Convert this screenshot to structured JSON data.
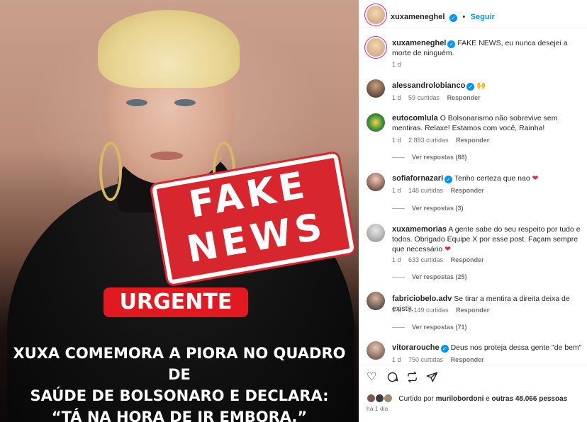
{
  "post": {
    "stamp_line1": "FAKE",
    "stamp_line2": "NEWS",
    "badge": "URGENTE",
    "headline_1": "XUXA COMEMORA A PIORA NO QUADRO DE",
    "headline_2": "SAÚDE DE BOLSONARO E DECLARA:",
    "headline_3": "“TÁ NA HORA DE IR EMBORA.”"
  },
  "header": {
    "username": "xuxameneghel",
    "separator": "•",
    "follow_label": "Seguir"
  },
  "caption": {
    "username": "xuxameneghel",
    "text": "FAKE NEWS, eu nunca desejei a morte de ninguém.",
    "time": "1 d"
  },
  "comments": [
    {
      "username": "alessandrolobianco",
      "verified": true,
      "text": "🙌",
      "time": "1 d",
      "likes": "59 curtidas",
      "reply": "Responder",
      "view_replies": ""
    },
    {
      "username": "eutocomlula",
      "verified": false,
      "text": "O Bolsonarismo não sobrevive sem mentiras. Relaxe! Estamos com você, Rainha!",
      "time": "1 d",
      "likes": "2.883 curtidas",
      "reply": "Responder",
      "view_replies": "Ver respostas (88)"
    },
    {
      "username": "sofiafornazari",
      "verified": true,
      "text": "Tenho certeza que nao",
      "time": "1 d",
      "likes": "148 curtidas",
      "reply": "Responder",
      "view_replies": "Ver respostas (3)"
    },
    {
      "username": "xuxamemorias",
      "verified": false,
      "text": "A gente sabe do seu respeito por tudo e todos. Obrigado Equipe X por esse post. Façam sempre que necessário",
      "time": "1 d",
      "likes": "633 curtidas",
      "reply": "Responder",
      "view_replies": "Ver respostas (25)"
    },
    {
      "username": "fabriciobelo.adv",
      "verified": false,
      "text": "Se tirar a mentira a direita deixa de existir.",
      "time": "1 d",
      "likes": "2.149 curtidas",
      "reply": "Responder",
      "view_replies": "Ver respostas (71)"
    },
    {
      "username": "vitorarouche",
      "verified": true,
      "text": "Deus nos proteja dessa gente \"de bem\"",
      "time": "1 d",
      "likes": "750 curtidas",
      "reply": "Responder",
      "view_replies": ""
    }
  ],
  "footer": {
    "liked_prefix": "Curtido por",
    "liked_user": "murilobordoni",
    "liked_suffix": "e",
    "liked_others": "outras 48.066 pessoas",
    "time": "há 1 dia"
  },
  "icons": {
    "verified": "verified-badge-icon",
    "heart": "heart-icon",
    "comment": "comment-icon",
    "share": "repost-icon",
    "send": "send-icon",
    "heart_emoji": "red-heart-icon"
  },
  "colors": {
    "accent": "#0095f6",
    "stamp_red": "#d7262d",
    "badge_red": "#e11a22",
    "muted": "#737373"
  }
}
